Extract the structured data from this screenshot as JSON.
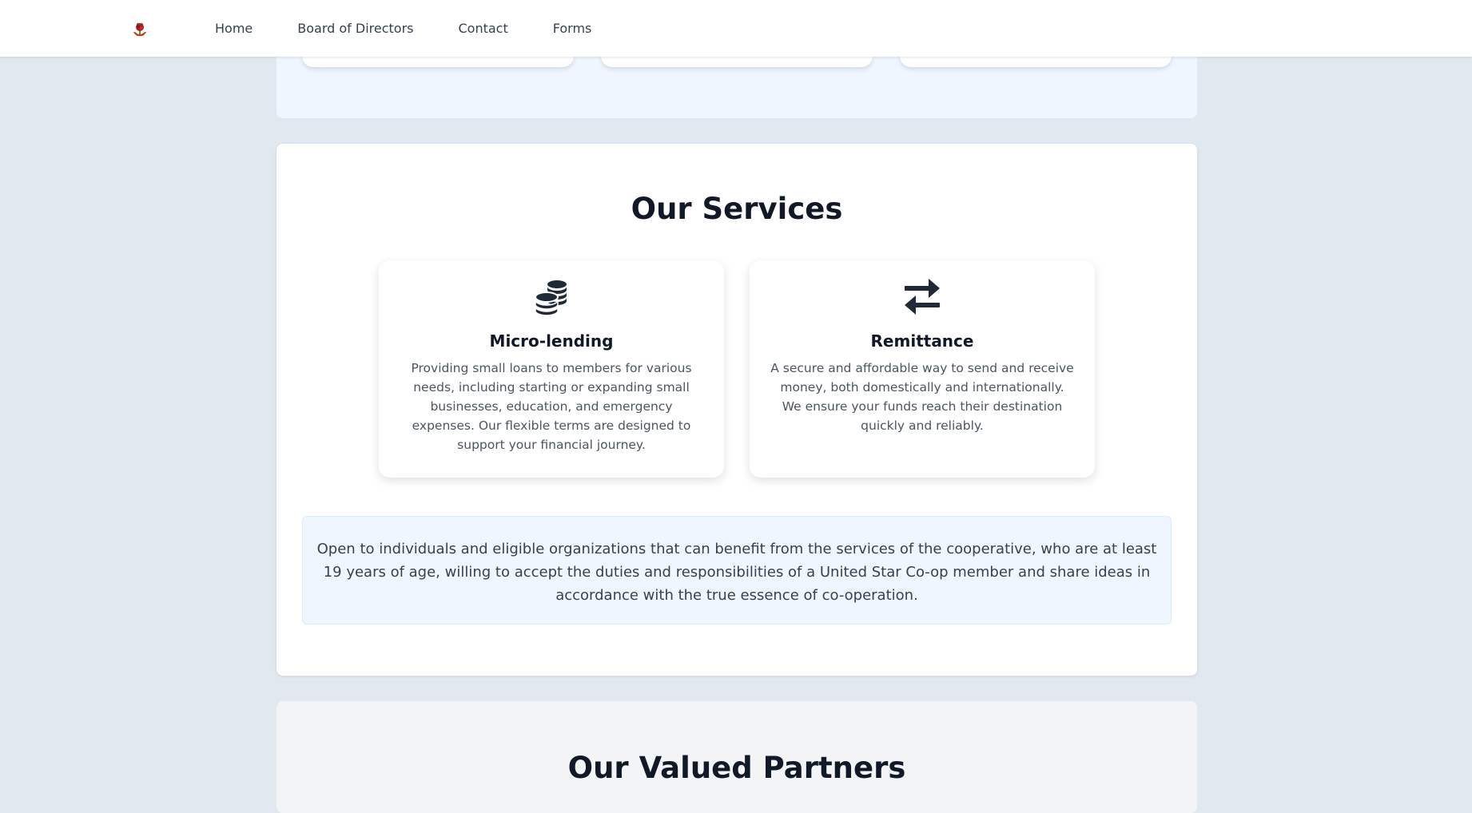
{
  "nav": {
    "logo_icon": "rose-hands-logo-icon",
    "items": [
      {
        "label": "Home"
      },
      {
        "label": "Board of Directors"
      },
      {
        "label": "Contact"
      },
      {
        "label": "Forms"
      }
    ]
  },
  "services": {
    "title": "Our Services",
    "cards": [
      {
        "icon": "coins-icon",
        "title": "Micro-lending",
        "description": "Providing small loans to members for various needs, including starting or expanding small businesses, education, and emergency expenses. Our flexible terms are designed to support your financial journey."
      },
      {
        "icon": "exchange-arrows-icon",
        "title": "Remittance",
        "description": "A secure and affordable way to send and receive money, both domestically and internationally. We ensure your funds reach their destination quickly and reliably."
      }
    ],
    "membership_note": "Open to individuals and eligible organizations that can benefit from the services of the cooperative, who are at least 19 years of age, willing to accept the duties and responsibilities of a United Star Co-op member and share ideas in accordance with the true essence of co-operation."
  },
  "partners": {
    "title": "Our Valued Partners"
  },
  "colors": {
    "page_bg": "#e2e8f0",
    "accent_light": "#eff6ff",
    "text_dark": "#111827",
    "text_muted": "#4b5563"
  }
}
